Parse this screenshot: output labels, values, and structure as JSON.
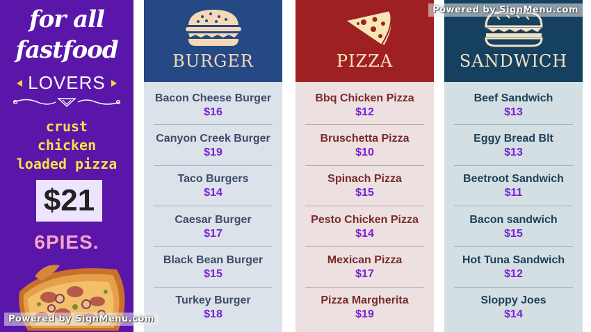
{
  "promo": {
    "line1": "for all",
    "line2": "fastfood",
    "lovers": "LOVERS",
    "deal_lines": [
      "crust",
      "chicken",
      "loaded pizza"
    ],
    "price": "$21",
    "quantity": "6PIES."
  },
  "categories": [
    {
      "title": "BURGER",
      "icon": "burger-icon",
      "header_color": "#244985",
      "items": [
        {
          "name": "Bacon Cheese Burger",
          "price": "$16"
        },
        {
          "name": "Canyon Creek Burger",
          "price": "$19"
        },
        {
          "name": "Taco Burgers",
          "price": "$14"
        },
        {
          "name": "Caesar Burger",
          "price": "$17"
        },
        {
          "name": "Black Bean Burger",
          "price": "$15"
        },
        {
          "name": "Turkey Burger",
          "price": "$18"
        }
      ]
    },
    {
      "title": "PIZZA",
      "icon": "pizza-slice-icon",
      "header_color": "#9e2023",
      "items": [
        {
          "name": "Bbq Chicken Pizza",
          "price": "$12"
        },
        {
          "name": "Bruschetta Pizza",
          "price": "$10"
        },
        {
          "name": "Spinach Pizza",
          "price": "$15"
        },
        {
          "name": "Pesto Chicken Pizza",
          "price": "$14"
        },
        {
          "name": "Mexican Pizza",
          "price": "$17"
        },
        {
          "name": "Pizza Margherita",
          "price": "$19"
        }
      ]
    },
    {
      "title": "SANDWICH",
      "icon": "sandwich-icon",
      "header_color": "#15405f",
      "items": [
        {
          "name": "Beef Sandwich",
          "price": "$13"
        },
        {
          "name": "Eggy Bread Blt",
          "price": "$13"
        },
        {
          "name": "Beetroot Sandwich",
          "price": "$11"
        },
        {
          "name": "Bacon sandwich",
          "price": "$15"
        },
        {
          "name": "Hot Tuna Sandwich",
          "price": "$12"
        },
        {
          "name": "Sloppy Joes",
          "price": "$14"
        }
      ]
    }
  ],
  "watermark": "Powered by SignMenu.com",
  "colors": {
    "promo_bg": "#5a16a8",
    "price_accent": "#7b1fd6",
    "deal_text": "#f4e14c"
  }
}
